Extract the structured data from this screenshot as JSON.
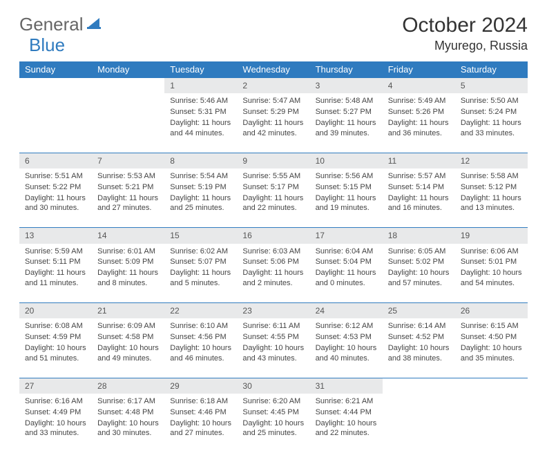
{
  "logo": {
    "part1": "General",
    "part2": "Blue"
  },
  "title": {
    "month": "October 2024",
    "location": "Myurego, Russia"
  },
  "weekdays": [
    "Sunday",
    "Monday",
    "Tuesday",
    "Wednesday",
    "Thursday",
    "Friday",
    "Saturday"
  ],
  "labels": {
    "sunrise": "Sunrise: ",
    "sunset": "Sunset: ",
    "daylight": "Daylight: "
  },
  "weeks": [
    [
      null,
      null,
      {
        "n": "1",
        "sr": "5:46 AM",
        "ss": "5:31 PM",
        "dl": "11 hours and 44 minutes."
      },
      {
        "n": "2",
        "sr": "5:47 AM",
        "ss": "5:29 PM",
        "dl": "11 hours and 42 minutes."
      },
      {
        "n": "3",
        "sr": "5:48 AM",
        "ss": "5:27 PM",
        "dl": "11 hours and 39 minutes."
      },
      {
        "n": "4",
        "sr": "5:49 AM",
        "ss": "5:26 PM",
        "dl": "11 hours and 36 minutes."
      },
      {
        "n": "5",
        "sr": "5:50 AM",
        "ss": "5:24 PM",
        "dl": "11 hours and 33 minutes."
      }
    ],
    [
      {
        "n": "6",
        "sr": "5:51 AM",
        "ss": "5:22 PM",
        "dl": "11 hours and 30 minutes."
      },
      {
        "n": "7",
        "sr": "5:53 AM",
        "ss": "5:21 PM",
        "dl": "11 hours and 27 minutes."
      },
      {
        "n": "8",
        "sr": "5:54 AM",
        "ss": "5:19 PM",
        "dl": "11 hours and 25 minutes."
      },
      {
        "n": "9",
        "sr": "5:55 AM",
        "ss": "5:17 PM",
        "dl": "11 hours and 22 minutes."
      },
      {
        "n": "10",
        "sr": "5:56 AM",
        "ss": "5:15 PM",
        "dl": "11 hours and 19 minutes."
      },
      {
        "n": "11",
        "sr": "5:57 AM",
        "ss": "5:14 PM",
        "dl": "11 hours and 16 minutes."
      },
      {
        "n": "12",
        "sr": "5:58 AM",
        "ss": "5:12 PM",
        "dl": "11 hours and 13 minutes."
      }
    ],
    [
      {
        "n": "13",
        "sr": "5:59 AM",
        "ss": "5:11 PM",
        "dl": "11 hours and 11 minutes."
      },
      {
        "n": "14",
        "sr": "6:01 AM",
        "ss": "5:09 PM",
        "dl": "11 hours and 8 minutes."
      },
      {
        "n": "15",
        "sr": "6:02 AM",
        "ss": "5:07 PM",
        "dl": "11 hours and 5 minutes."
      },
      {
        "n": "16",
        "sr": "6:03 AM",
        "ss": "5:06 PM",
        "dl": "11 hours and 2 minutes."
      },
      {
        "n": "17",
        "sr": "6:04 AM",
        "ss": "5:04 PM",
        "dl": "11 hours and 0 minutes."
      },
      {
        "n": "18",
        "sr": "6:05 AM",
        "ss": "5:02 PM",
        "dl": "10 hours and 57 minutes."
      },
      {
        "n": "19",
        "sr": "6:06 AM",
        "ss": "5:01 PM",
        "dl": "10 hours and 54 minutes."
      }
    ],
    [
      {
        "n": "20",
        "sr": "6:08 AM",
        "ss": "4:59 PM",
        "dl": "10 hours and 51 minutes."
      },
      {
        "n": "21",
        "sr": "6:09 AM",
        "ss": "4:58 PM",
        "dl": "10 hours and 49 minutes."
      },
      {
        "n": "22",
        "sr": "6:10 AM",
        "ss": "4:56 PM",
        "dl": "10 hours and 46 minutes."
      },
      {
        "n": "23",
        "sr": "6:11 AM",
        "ss": "4:55 PM",
        "dl": "10 hours and 43 minutes."
      },
      {
        "n": "24",
        "sr": "6:12 AM",
        "ss": "4:53 PM",
        "dl": "10 hours and 40 minutes."
      },
      {
        "n": "25",
        "sr": "6:14 AM",
        "ss": "4:52 PM",
        "dl": "10 hours and 38 minutes."
      },
      {
        "n": "26",
        "sr": "6:15 AM",
        "ss": "4:50 PM",
        "dl": "10 hours and 35 minutes."
      }
    ],
    [
      {
        "n": "27",
        "sr": "6:16 AM",
        "ss": "4:49 PM",
        "dl": "10 hours and 33 minutes."
      },
      {
        "n": "28",
        "sr": "6:17 AM",
        "ss": "4:48 PM",
        "dl": "10 hours and 30 minutes."
      },
      {
        "n": "29",
        "sr": "6:18 AM",
        "ss": "4:46 PM",
        "dl": "10 hours and 27 minutes."
      },
      {
        "n": "30",
        "sr": "6:20 AM",
        "ss": "4:45 PM",
        "dl": "10 hours and 25 minutes."
      },
      {
        "n": "31",
        "sr": "6:21 AM",
        "ss": "4:44 PM",
        "dl": "10 hours and 22 minutes."
      },
      null,
      null
    ]
  ]
}
